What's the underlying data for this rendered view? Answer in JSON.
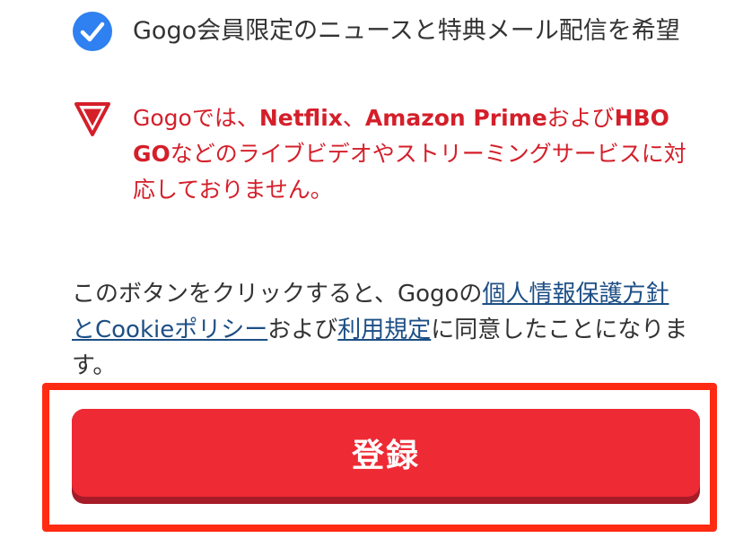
{
  "consent": {
    "checked": true,
    "label": "Gogo会員限定のニュースと特典メール配信を希望",
    "icon": "checkmark-circle-icon"
  },
  "warning": {
    "icon": "warning-triangle-icon",
    "color": "#d41f2a",
    "part1": "Gogoでは、",
    "netflix": "Netflix",
    "sep": "、",
    "amazon": "Amazon Prime",
    "and": "および",
    "hbo": "HBO GO",
    "rest": "などのライブビデオやストリーミングサービスに対応しておりません。"
  },
  "agreement": {
    "prefix": "このボタンをクリックすると、Gogoの",
    "privacy_link": "個人情報保護方針とCookieポリシー",
    "middle": "および",
    "terms_link": "利用規定",
    "suffix": "に同意したことになります。"
  },
  "register_button": {
    "label": "登録",
    "color": "#ee2a35",
    "highlight_color": "#ff2a12"
  }
}
